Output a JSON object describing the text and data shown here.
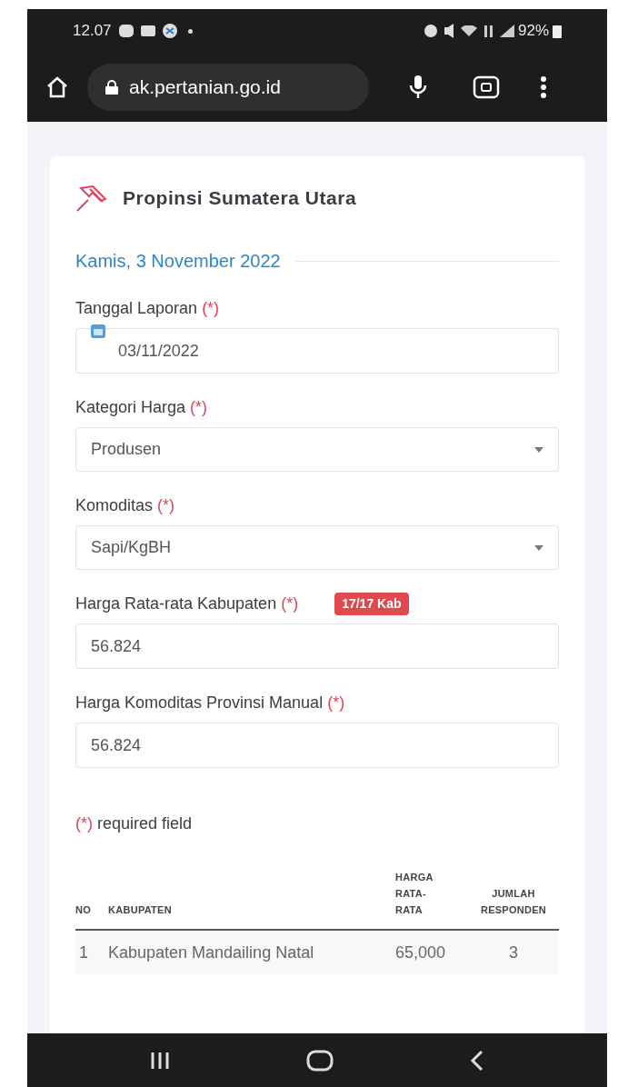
{
  "status_bar": {
    "time": "12.07",
    "battery": "92%"
  },
  "browser": {
    "url": "ak.pertanian.go.id"
  },
  "card": {
    "title": "Propinsi Sumatera Utara",
    "date_heading": "Kamis, 3 November 2022",
    "fields": [
      {
        "kind": "date",
        "label": "Tanggal Laporan",
        "required_mark": "(*)",
        "value": "03/11/2022"
      },
      {
        "kind": "select",
        "label": "Kategori Harga",
        "required_mark": "(*)",
        "value": "Produsen"
      },
      {
        "kind": "select",
        "label": "Komoditas",
        "required_mark": "(*)",
        "value": "Sapi/KgBH"
      },
      {
        "kind": "text",
        "label": "Harga Rata-rata Kabupaten",
        "required_mark": "(*)",
        "badge": "17/17 Kab",
        "value": "56.824"
      },
      {
        "kind": "text",
        "label": "Harga Komoditas Provinsi Manual",
        "required_mark": "(*)",
        "value": "56.824"
      }
    ],
    "required_note": {
      "mark": "(*)",
      "text": "required field"
    },
    "table": {
      "columns": [
        "NO",
        "KABUPATEN",
        "HARGA RATA-RATA",
        "JUMLAH RESPONDEN"
      ],
      "rows": [
        [
          "1",
          "Kabupaten Mandailing Natal",
          "65,000",
          "3"
        ]
      ]
    }
  }
}
